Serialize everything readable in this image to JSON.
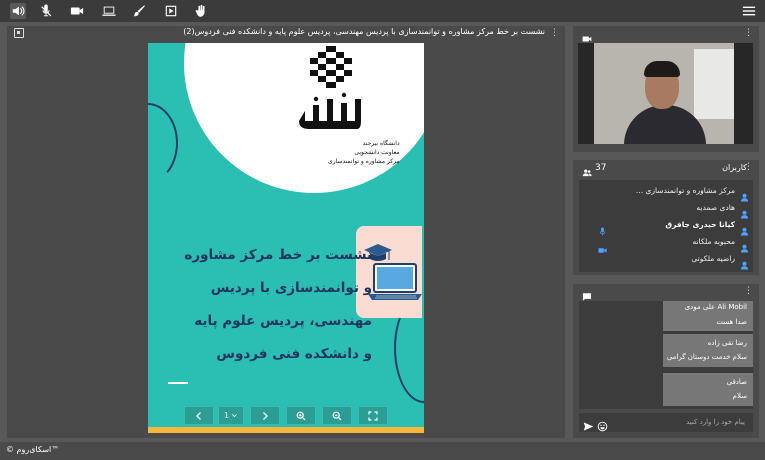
{
  "toolbar": {
    "icons": [
      "speaker-icon",
      "mic-off-icon",
      "camera-icon",
      "screen-share-icon",
      "brush-icon",
      "play-icon",
      "hand-icon"
    ],
    "menu_icon": "hamburger-menu-icon"
  },
  "presentation": {
    "title": "نشست بر خط مرکز مشاوره و توانمندسازی با پردیس مهندسی، پردیس علوم پایه و دانشکده فنی فردوس(2)",
    "slide": {
      "logo_sub_lines": [
        "دانشگاه بیرجند",
        "معاونت دانشجویی",
        "مرکز مشاوره و توانمندسازی"
      ],
      "lines": [
        "نشست بر خط مرکز مشاوره",
        "و توانمندسازی با پردیس",
        "مهندسی، پردیس علوم پایه",
        "و دانشکده فنی فردوس"
      ],
      "colors": {
        "background": "#2bbfb3",
        "text": "#1f3560",
        "accent": "#f6b73c"
      }
    },
    "controls": {
      "page": "1",
      "page_dropdown_icon": "chevron-down-icon"
    }
  },
  "users": {
    "title": "کاربران",
    "count": "37",
    "list": [
      {
        "name": "مرکز مشاوره و توانمندسازی ...",
        "bold": false
      },
      {
        "name": "هادی صمدیه",
        "bold": false
      },
      {
        "name": "کیانا حیدری جافرق",
        "bold": true
      },
      {
        "name": "محبوبه ملکانه",
        "bold": false
      },
      {
        "name": "راضیه ملکوتی",
        "bold": false
      }
    ]
  },
  "chat": {
    "messages": [
      {
        "name": "Ali Mobil علی مودی",
        "text": "صدا هست"
      },
      {
        "name": "رضا تقی زاده",
        "text": "سلام خدمت دوستان گرامی"
      },
      {
        "name": "صادقی",
        "text": "سلام"
      }
    ],
    "placeholder": "پیام خود را وارد کنید"
  },
  "footer": {
    "brand": "© اسکای‌روم™"
  }
}
